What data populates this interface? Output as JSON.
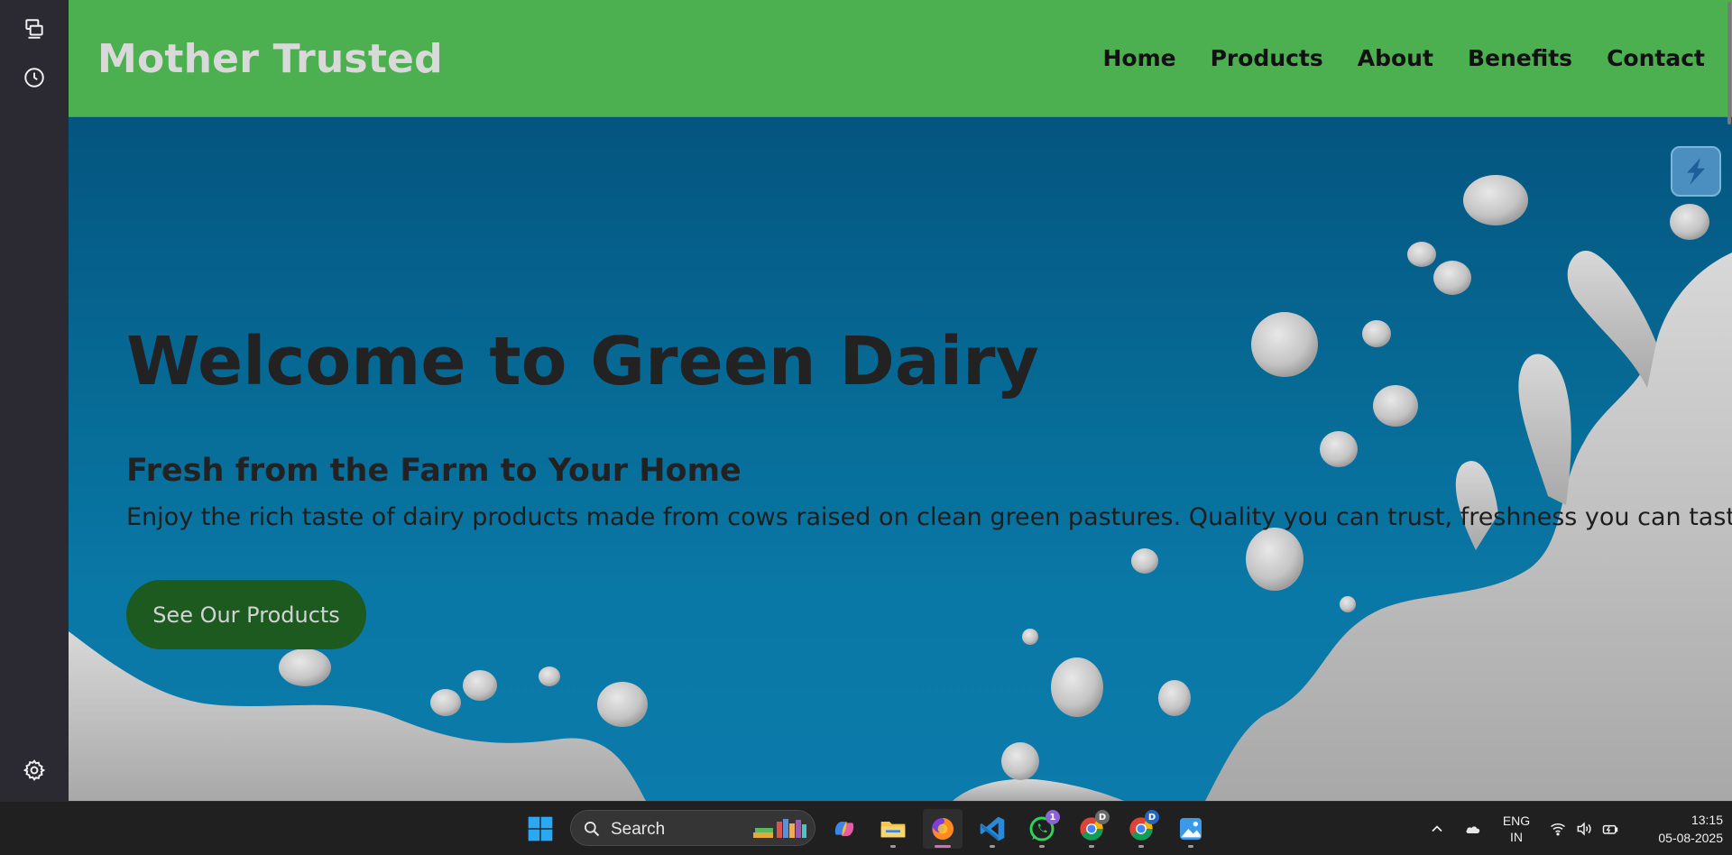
{
  "site": {
    "brand": "Mother Trusted",
    "nav": [
      "Home",
      "Products",
      "About",
      "Benefits",
      "Contact"
    ]
  },
  "hero": {
    "title": "Welcome to Green Dairy",
    "subtitle": "Fresh from the Farm to Your Home",
    "text": "Enjoy the rich taste of dairy products made from cows raised on clean green pastures. Quality you can trust, freshness you can taste.",
    "cta": "See Our Products"
  },
  "colors": {
    "navbar": "#4caf50",
    "hero_blue": "#066893",
    "cta": "#1d5a20",
    "brand_text": "#d9d9d9"
  },
  "browser_sidebar": {
    "icons": [
      "sync-tabs-icon",
      "history-icon",
      "settings-icon"
    ]
  },
  "taskbar": {
    "search_placeholder": "Search",
    "apps": [
      "windows-start-icon",
      "copilot-icon",
      "file-explorer-icon",
      "firefox-icon",
      "vscode-icon",
      "whatsapp-icon",
      "chrome-icon",
      "chrome-icon",
      "photos-icon"
    ],
    "whatsapp_badge": "1",
    "chrome_profile_1": "D",
    "chrome_profile_2": "D",
    "lang_line1": "ENG",
    "lang_line2": "IN",
    "time": "13:15",
    "date": "05-08-2025"
  }
}
